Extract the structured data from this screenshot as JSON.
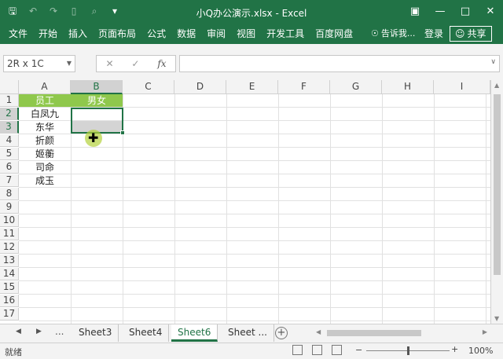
{
  "titlebar": {
    "title": "小Q办公演示.xlsx - Excel",
    "qat_icons": [
      "save-icon",
      "undo-icon",
      "redo-icon",
      "new-icon",
      "print-preview-icon",
      "customize-qat-icon"
    ],
    "window_icons": [
      "ribbon-display-icon",
      "minimize-icon",
      "maximize-icon",
      "close-icon"
    ]
  },
  "ribbon": {
    "tabs": [
      "文件",
      "开始",
      "插入",
      "页面布局",
      "公式",
      "数据",
      "审阅",
      "视图",
      "开发工具",
      "百度网盘"
    ],
    "tell_me": "告诉我...",
    "login": "登录",
    "share": "共享"
  },
  "formula_bar": {
    "name_box": "2R x 1C",
    "cancel": "✕",
    "enter": "✓",
    "fx": "fx",
    "content": ""
  },
  "grid": {
    "columns": [
      "A",
      "B",
      "C",
      "D",
      "E",
      "F",
      "G",
      "H",
      "I"
    ],
    "rows": [
      "1",
      "2",
      "3",
      "4",
      "5",
      "6",
      "7",
      "8",
      "9",
      "10",
      "11",
      "12",
      "13",
      "14",
      "15",
      "16",
      "17"
    ],
    "selected_column": "B",
    "selected_rows": [
      "2",
      "3"
    ],
    "header_row": [
      "员工",
      "男女"
    ],
    "column_a": [
      "白凤九",
      "东华",
      "折颜",
      "姬蘅",
      "司命",
      "成玉"
    ]
  },
  "sheets": {
    "tabs": [
      "Sheet3",
      "Sheet4",
      "Sheet6",
      "Sheet ..."
    ],
    "active": "Sheet6",
    "more": "..."
  },
  "status": {
    "ready": "就绪",
    "zoom": "100%"
  },
  "colors": {
    "accent": "#217346",
    "header_fill": "#8fc84c"
  }
}
